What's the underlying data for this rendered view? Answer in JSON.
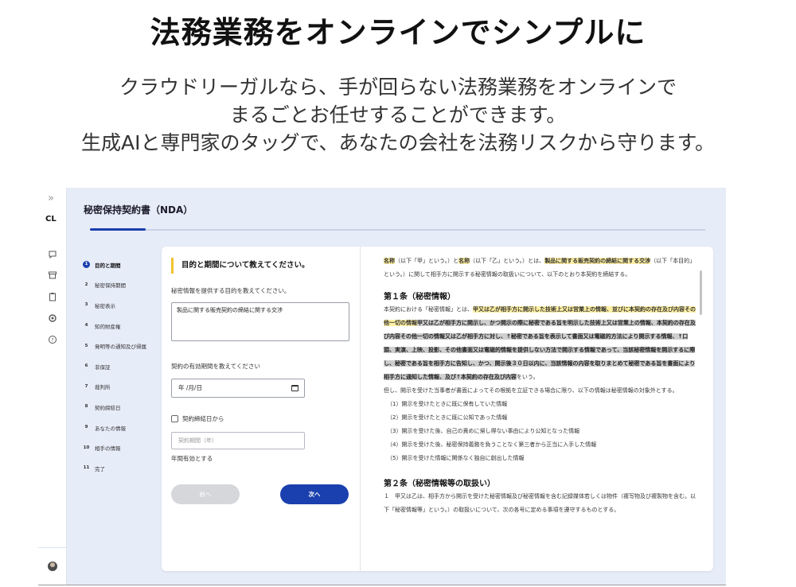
{
  "hero": {
    "title": "法務業務をオンラインでシンプルに",
    "line1": "クラウドリーガルなら、手が回らない法務業務をオンラインで",
    "line2": "まるごとお任せすることができます。",
    "line3": "生成AIと専門家のタッグで、あなたの会社を法務リスクから守ります。"
  },
  "rail": {
    "chevron": "»",
    "logo": "CL",
    "icons": [
      "chat-icon",
      "archive-icon",
      "clipboard-icon",
      "gear-icon",
      "help-icon"
    ],
    "avatar": "avatar"
  },
  "document": {
    "title": "秘密保持契約書（NDA）",
    "progress": 0.09
  },
  "steps": [
    {
      "num": "1",
      "label": "目的と期間"
    },
    {
      "num": "2",
      "label": "秘密保持期間"
    },
    {
      "num": "3",
      "label": "秘密表示"
    },
    {
      "num": "4",
      "label": "知的財産権"
    },
    {
      "num": "5",
      "label": "発明等の通知及び帰属"
    },
    {
      "num": "6",
      "label": "非保証"
    },
    {
      "num": "7",
      "label": "裁判所"
    },
    {
      "num": "8",
      "label": "契約締結日"
    },
    {
      "num": "9",
      "label": "あなたの情報"
    },
    {
      "num": "10",
      "label": "相手の情報"
    },
    {
      "num": "11",
      "label": "完了"
    }
  ],
  "form": {
    "heading": "目的と期間について教えてください。",
    "purpose_label": "秘密情報を提供する目的を教えてください。",
    "purpose_value": "製品に関する販売契約の締結に関する交渉",
    "term_label": "契約の有効期間を教えてください",
    "date_value": "年 /月/日",
    "checkbox_label": "契約締結日から",
    "period_placeholder": "契約期間（年）",
    "period_suffix": "年間有効とする",
    "prev_label": "前へ",
    "next_label": "次へ"
  },
  "preview": {
    "intro_a": "名称",
    "intro_b": "（以下「甲」という。）と",
    "intro_c": "名称",
    "intro_d": "（以下「乙」という。）とは、",
    "intro_e": "製品に関する販売契約の締結に関する交渉",
    "intro_f": "（以下「本目的」という。）に関して相手方に開示する秘密情報の取扱いについて、以下のとおり本契約を締結する。",
    "art1_title": "第１条（秘密情報）",
    "art1_a": "本契約における「秘密情報」とは、",
    "art1_b": "甲又は乙が相手方に開示した技術上又は営業上の情報、並びに本契約の存在及び内容その他一切の情報",
    "art1_c": "甲又は乙が相手方に開示し、かつ開示の際に秘密である旨を明示した技術上又は営業上の情報、本契約の存在及び内容その他一切の情報又は乙が相手方に対し、↑秘密である旨を表示して書面又は電磁的方法により開示する情報、↑口頭、実演、上映、投影、その他書面又は電磁的情報を提供しない方法で開示する情報であって、当該秘密情報を開示するに際し、秘密である旨を相手方に告知し、かつ、開示後３０日以内に、当該情報の内容を取りまとめて秘密である旨を書面により相手方に通知した情報、及び↑本契約の存在及び内容",
    "art1_d": "をいう。",
    "art1_e": "但し、開示を受けた当事者が書面によってその根拠を立証できる場合に限り、以下の情報は秘密情報の対象外とする。",
    "items": [
      "（1）開示を受けたときに既に保有していた情報",
      "（2）開示を受けたときに既に公知であった情報",
      "（3）開示を受けた後、自己の責めに帰し得ない事由により公知となった情報",
      "（4）開示を受けた後、秘密保持義務を負うことなく第三者から正当に入手した情報",
      "（5）開示を受けた情報に関係なく独自に創出した情報"
    ],
    "art2_title": "第２条（秘密情報等の取扱い）",
    "art2_a": "１　甲又は乙は、相手方から開示を受けた秘密情報及び秘密情報を含む記録媒体若しくは物件（複写物及び複製物を含む。以下「秘密情報等」という。）の取扱いについて、次の各号に定める事項を遵守するものとする。"
  }
}
